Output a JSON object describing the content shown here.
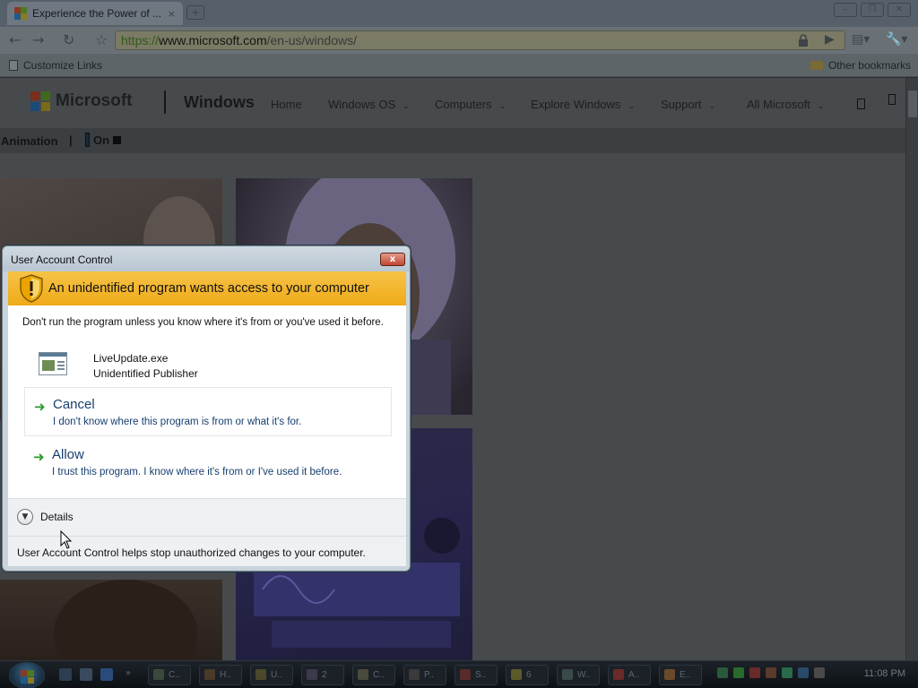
{
  "browser": {
    "tab_title": "Experience the Power of ...",
    "tab_close": "×",
    "new_tab": "+",
    "url_scheme": "https://",
    "url_host": "www.microsoft.com",
    "url_path": "/en-us/windows/",
    "bookmarks_left": "Customize Links",
    "bookmarks_right": "Other bookmarks"
  },
  "site": {
    "brand": "Microsoft",
    "product": "Windows",
    "nav": [
      "Home",
      "Windows OS",
      "Computers",
      "Explore Windows",
      "Support",
      "All Microsoft"
    ],
    "animation_label": "Animation",
    "animation_sep": "|",
    "animation_state": "On"
  },
  "uac": {
    "title": "User Account Control",
    "close_glyph": "x",
    "heading": "An unidentified program wants access to your computer",
    "warning": "Don't run the program unless you know where it's from or you've used it before.",
    "program_name": "LiveUpdate.exe",
    "publisher": "Unidentified Publisher",
    "cancel_title": "Cancel",
    "cancel_desc": "I don't know where this program is from or what it's for.",
    "allow_title": "Allow",
    "allow_desc": "I trust this program. I know where it's from or I've used it before.",
    "details": "Details",
    "footer": "User Account Control helps stop unauthorized changes to your computer."
  },
  "taskbar": {
    "buttons": [
      "C..",
      "H..",
      "U..",
      "2",
      "C..",
      "P..",
      "S..",
      "6",
      "W..",
      "A..",
      "E.."
    ],
    "clock": "11:08 PM"
  },
  "colors": {
    "uac_banner": "#f0b020",
    "uac_close": "#c34530",
    "link_text": "#163f6e",
    "arrow": "#2a9a2a"
  }
}
